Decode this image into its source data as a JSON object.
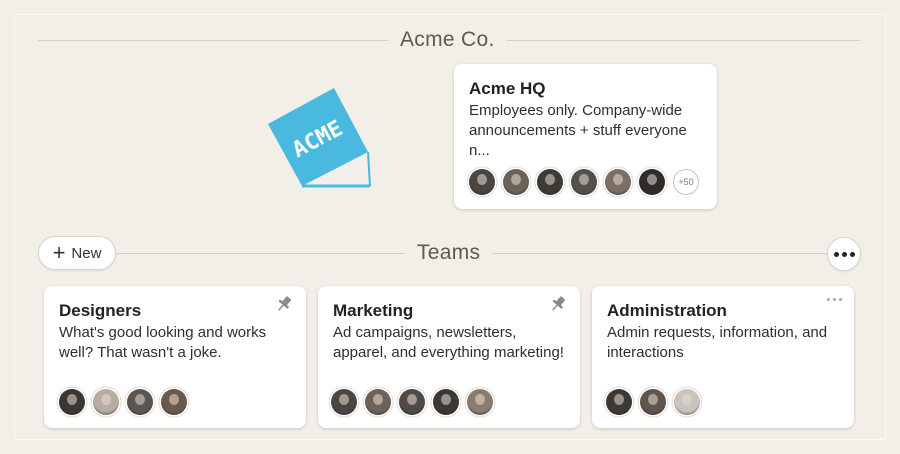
{
  "company": {
    "name": "Acme Co.",
    "logo_text": "ACME",
    "logo_color": "#4ab9e0"
  },
  "hq": {
    "title": "Acme HQ",
    "description": "Employees only. Company-wide announcements + stuff everyone n...",
    "more_count": "+50",
    "avatar_colors": [
      "#4a4540",
      "#6b625a",
      "#3e3a36",
      "#54504b",
      "#7a6f65",
      "#2f2b28"
    ]
  },
  "teams_section": {
    "title": "Teams",
    "new_label": "New"
  },
  "teams": [
    {
      "title": "Designers",
      "description": "What's good looking and works well? That wasn't a joke.",
      "pinned": true,
      "avatar_colors": [
        "#3a3733",
        "#b6aca2",
        "#5c5650",
        "#6a5a4e"
      ]
    },
    {
      "title": "Marketing",
      "description": "Ad campaigns, newsletters, apparel, and everything marketing!",
      "pinned": true,
      "avatar_colors": [
        "#4b4641",
        "#6d6259",
        "#4f4a45",
        "#3b3733",
        "#8a7d70"
      ]
    },
    {
      "title": "Administration",
      "description": "Admin requests, information, and interactions",
      "pinned": false,
      "avatar_colors": [
        "#3d3935",
        "#5d554e",
        "#c9c4bd"
      ]
    }
  ]
}
